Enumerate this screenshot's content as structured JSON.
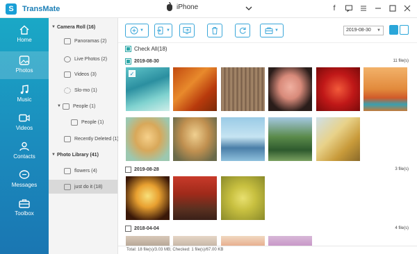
{
  "app": {
    "name": "TransMate",
    "device": "iPhone"
  },
  "sidebar": [
    {
      "label": "Home",
      "icon": "home-icon"
    },
    {
      "label": "Photos",
      "icon": "photo-icon"
    },
    {
      "label": "Music",
      "icon": "music-icon"
    },
    {
      "label": "Videos",
      "icon": "video-icon"
    },
    {
      "label": "Contacts",
      "icon": "contacts-icon"
    },
    {
      "label": "Messages",
      "icon": "messages-icon"
    },
    {
      "label": "Toolbox",
      "icon": "toolbox-icon"
    }
  ],
  "tree": {
    "camera_roll": "Camera Roll (16)",
    "panoramas": "Panoramas (2)",
    "live_photos": "Live Photos (2)",
    "videos": "Videos (3)",
    "slomo": "Slo-mo (1)",
    "people_group": "People (1)",
    "people": "People (1)",
    "recently_deleted": "Recently Deleted (1)",
    "photo_library": "Photo Library (41)",
    "flowers": "flowers (4)",
    "just_do_it": "just do it (18)"
  },
  "toolbar": {
    "date": "2019-08-30"
  },
  "check_all": "Check All(18)",
  "groups": [
    {
      "date": "2019-08-30",
      "count": "11 file(s)"
    },
    {
      "date": "2019-08-28",
      "count": "3 file(s)"
    },
    {
      "date": "2018-04-04",
      "count": "4 file(s)"
    }
  ],
  "status": "Total: 18 file(s)/3.03 MB; Checked: 1 file(s)/67.00 KB",
  "colors": {
    "sidebar_top": "#1aa8c6",
    "sidebar_bottom": "#1a76b2",
    "accent": "#2aa6d9"
  }
}
